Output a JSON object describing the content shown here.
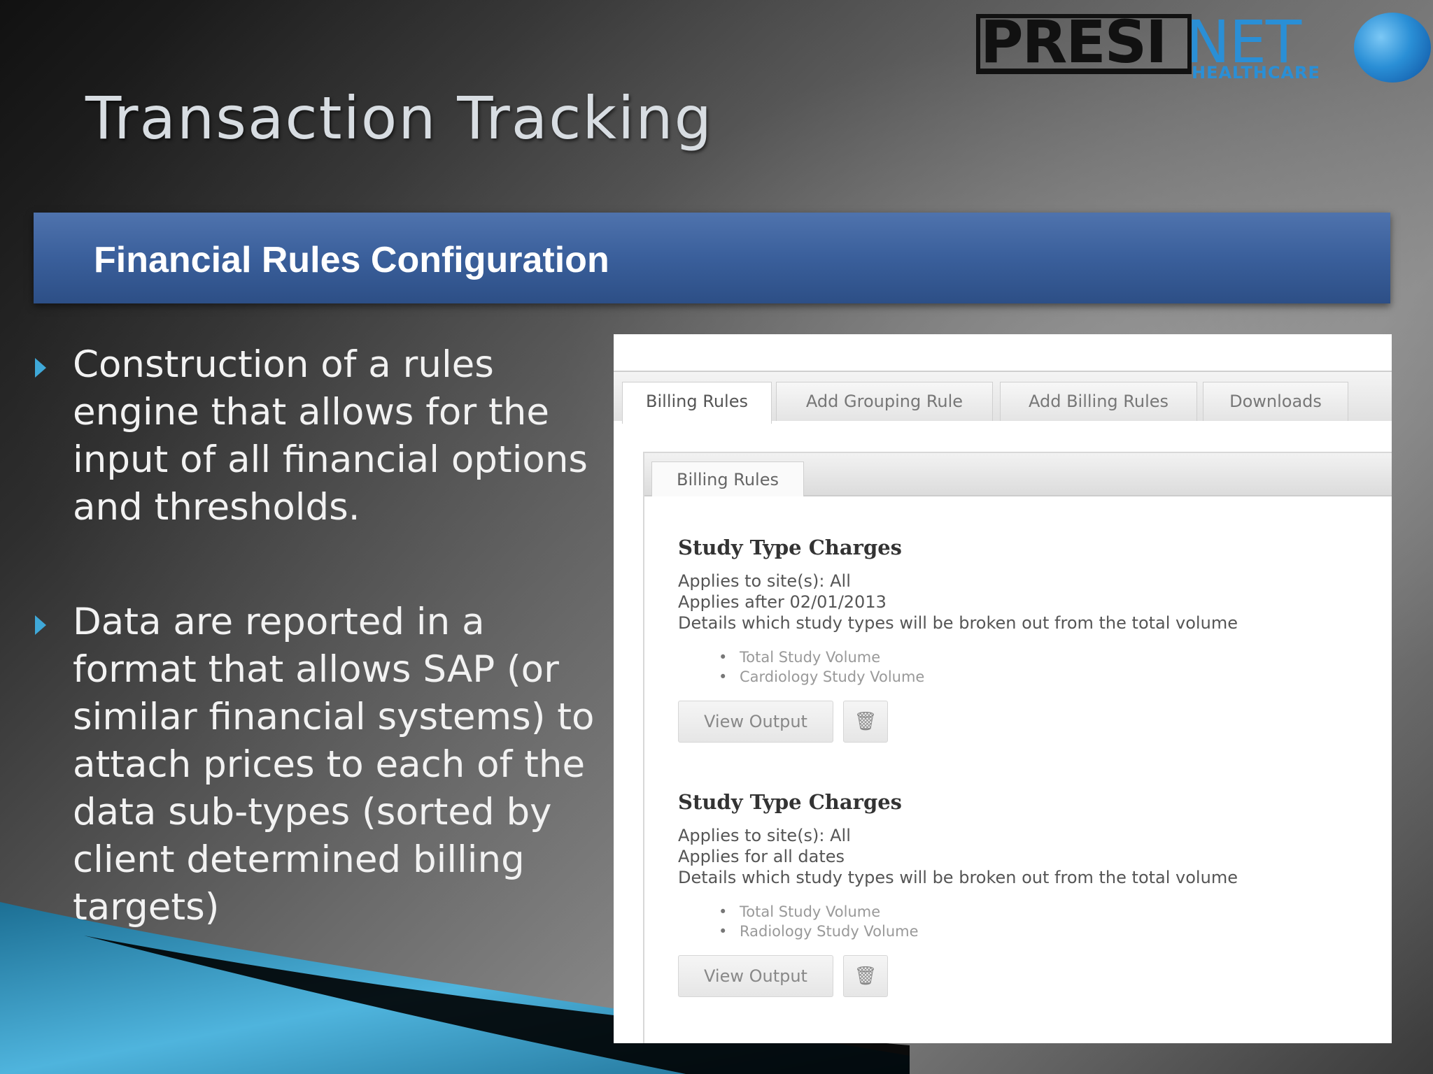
{
  "slide": {
    "title": "Transaction Tracking",
    "section_heading": "Financial Rules Configuration",
    "logo": {
      "wordmark_left": "PRESI",
      "wordmark_right": "NET",
      "tagline": "HEALTHCARE",
      "accent_color": "#2a8fd6"
    },
    "bullets": [
      {
        "text": "Construction of a rules engine that allows for the input of all financial options and thresholds."
      },
      {
        "text": "Data are reported in a format that allows SAP (or similar financial systems) to attach prices to each of the data sub-types (sorted by client determined billing targets)"
      }
    ],
    "banner_color": "#3a5f9b",
    "bullet_color": "#3fa8d8"
  },
  "app": {
    "tabs": [
      {
        "label": "Billing Rules",
        "active": true
      },
      {
        "label": "Add Grouping Rule",
        "active": false
      },
      {
        "label": "Add Billing Rules",
        "active": false
      },
      {
        "label": "Downloads",
        "active": false
      }
    ],
    "inner_tab": "Billing Rules",
    "rules": [
      {
        "title": "Study Type Charges",
        "sites": "Applies to site(s): All",
        "date": "Applies after 02/01/2013",
        "details": "Details which study types will be broken out from the total volume",
        "items": [
          "Total Study Volume",
          "Cardiology Study Volume"
        ],
        "view_button": "View Output",
        "delete_icon": "trash-icon"
      },
      {
        "title": "Study Type Charges",
        "sites": "Applies to site(s): All",
        "date": "Applies for all dates",
        "details": "Details which study types will be broken out from the total volume",
        "items": [
          "Total Study Volume",
          "Radiology Study Volume"
        ],
        "view_button": "View Output",
        "delete_icon": "trash-icon"
      }
    ]
  }
}
